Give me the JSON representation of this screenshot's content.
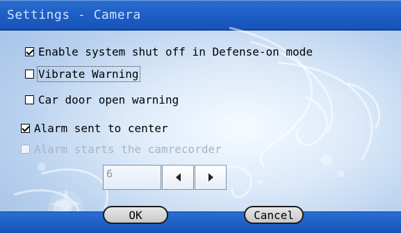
{
  "window": {
    "title": "Settings - Camera"
  },
  "options": [
    {
      "label": "Enable system shut off in Defense-on mode",
      "checked": true,
      "enabled": true
    },
    {
      "label": "Vibrate Warning",
      "checked": false,
      "enabled": true
    },
    {
      "label": "Car door open warning",
      "checked": false,
      "enabled": true
    },
    {
      "label": "Alarm sent to center",
      "checked": true,
      "enabled": true
    },
    {
      "label": "Alarm starts the camrecorder",
      "checked": false,
      "enabled": false
    }
  ],
  "stepper": {
    "value": "6"
  },
  "buttons": {
    "ok": "OK",
    "cancel": "Cancel"
  },
  "colors": {
    "titlebar": "#1f5fc6",
    "background": "#c6dbf3",
    "disabled_text": "#a8b4c4"
  }
}
